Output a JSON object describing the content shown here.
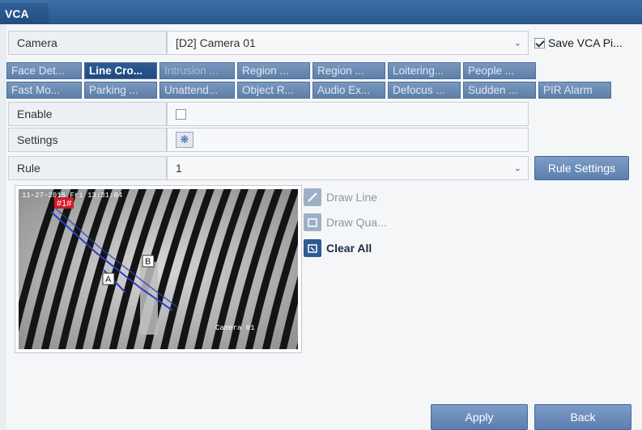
{
  "window": {
    "title": "VCA"
  },
  "camera": {
    "label": "Camera",
    "value": "[D2] Camera 01",
    "save_label": "Save VCA Pi...",
    "save_checked": true
  },
  "tabs_row1": [
    "Face Det...",
    "Line Cro...",
    "Intrusion ...",
    "Region ...",
    "Region ...",
    "Loitering...",
    "People ..."
  ],
  "tabs_row2": [
    "Fast Mo...",
    "Parking ...",
    "Unattend...",
    "Object R...",
    "Audio Ex...",
    "Defocus ...",
    "Sudden ...",
    "PIR Alarm"
  ],
  "active_tab": "Line Cro...",
  "enable": {
    "label": "Enable",
    "checked": false
  },
  "settings": {
    "label": "Settings",
    "icon": "gear-icon"
  },
  "rule": {
    "label": "Rule",
    "value": "1",
    "button": "Rule Settings"
  },
  "preview": {
    "timestamp": "11-27-2015 Fri 13:31:04",
    "line_tag": "#1#",
    "marker_a": "A",
    "marker_b": "B",
    "camera_name": "Camera 01"
  },
  "tools": {
    "draw_line": "Draw Line",
    "draw_quad": "Draw Qua...",
    "clear_all": "Clear All"
  },
  "footer": {
    "apply": "Apply",
    "back": "Back"
  },
  "colors": {
    "accent": "#2c5b94",
    "tab": "#6a8bb5",
    "detection_line": "#2a3fbf",
    "tag_red": "#d21a2a"
  }
}
